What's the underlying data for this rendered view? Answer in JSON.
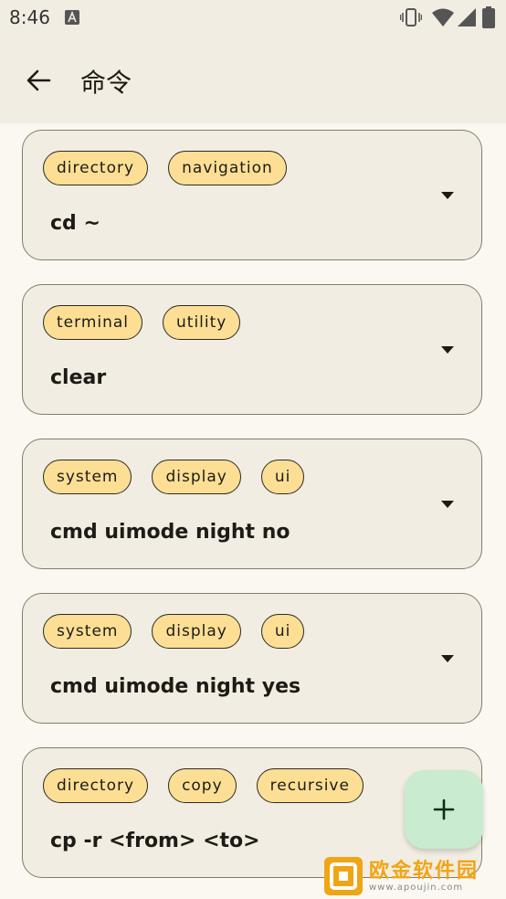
{
  "status_bar": {
    "time": "8:46"
  },
  "app_bar": {
    "title": "命令"
  },
  "commands": [
    {
      "tags": [
        "directory",
        "navigation"
      ],
      "command": "cd ~"
    },
    {
      "tags": [
        "terminal",
        "utility"
      ],
      "command": "clear"
    },
    {
      "tags": [
        "system",
        "display",
        "ui"
      ],
      "command": "cmd uimode night no"
    },
    {
      "tags": [
        "system",
        "display",
        "ui"
      ],
      "command": "cmd uimode night yes"
    },
    {
      "tags": [
        "directory",
        "copy",
        "recursive"
      ],
      "command": "cp -r <from> <to>"
    }
  ],
  "fab": {
    "icon": "plus-icon"
  },
  "watermark": {
    "name": "欧金软件园",
    "url": "www.apoujin.com"
  },
  "colors": {
    "tag_fill": "#fcdf95",
    "fab_fill": "#c9ebcf",
    "background": "#f2ede2"
  }
}
